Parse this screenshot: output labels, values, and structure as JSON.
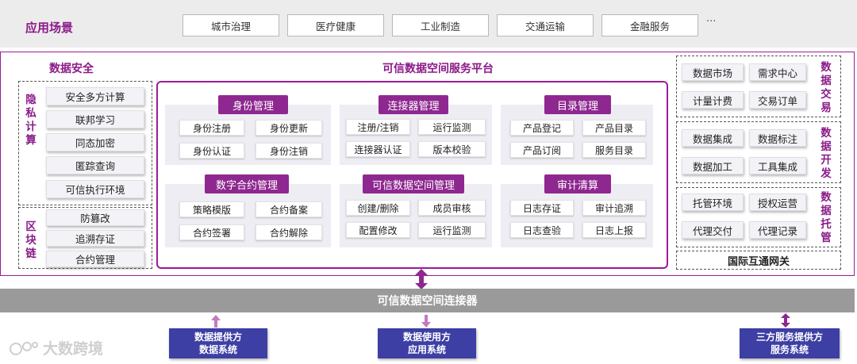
{
  "scenarios": {
    "title": "应用场景",
    "items": [
      "城市治理",
      "医疗健康",
      "工业制造",
      "交通运输",
      "金融服务"
    ],
    "more": "···"
  },
  "data_security": {
    "title": "数据安全",
    "privacy": {
      "label": [
        "隐",
        "私",
        "计",
        "算"
      ],
      "items": [
        "安全多方计算",
        "联邦学习",
        "同态加密",
        "匿踪查询",
        "可信执行环境"
      ]
    },
    "blockchain": {
      "label": [
        "区",
        "块",
        "链"
      ],
      "items": [
        "防篡改",
        "追溯存证",
        "合约管理"
      ]
    }
  },
  "platform": {
    "title": "可信数据空间服务平台",
    "modules": [
      {
        "title": "身份管理",
        "items": [
          "身份注册",
          "身份更新",
          "身份认证",
          "身份注销"
        ]
      },
      {
        "title": "连接器管理",
        "items": [
          "注册/注销",
          "运行监测",
          "连接器认证",
          "版本校验"
        ]
      },
      {
        "title": "目录管理",
        "items": [
          "产品登记",
          "产品目录",
          "产品订阅",
          "服务目录"
        ]
      },
      {
        "title": "数字合约管理",
        "items": [
          "策略模版",
          "合约备案",
          "合约签署",
          "合约解除"
        ]
      },
      {
        "title": "可信数据空间管理",
        "items": [
          "创建/删除",
          "成员审核",
          "配置修改",
          "运行监测"
        ]
      },
      {
        "title": "审计清算",
        "items": [
          "日志存证",
          "审计追溯",
          "日志查验",
          "日志上报"
        ]
      }
    ]
  },
  "right_groups": [
    {
      "label": [
        "数",
        "据",
        "交",
        "易"
      ],
      "items": [
        "数据市场",
        "需求中心",
        "计量计费",
        "交易订单"
      ]
    },
    {
      "label": [
        "数",
        "据",
        "开",
        "发"
      ],
      "items": [
        "数据集成",
        "数据标注",
        "数据加工",
        "工具集成"
      ]
    },
    {
      "label": [
        "数",
        "据",
        "托",
        "管"
      ],
      "items": [
        "托管环境",
        "授权运营",
        "代理交付",
        "代理记录"
      ]
    }
  ],
  "gateway": "国际互通网关",
  "connector": "可信数据空间连接器",
  "bottom": {
    "provider": [
      "数据提供方",
      "数据系统"
    ],
    "user": [
      "数据使用方",
      "应用系统"
    ],
    "third_party": [
      "三方服务提供方",
      "服务系统"
    ]
  },
  "watermark": "大数跨境",
  "colors": {
    "accent": "#8a1a88",
    "module_title": "#8e2890",
    "connector_bar": "#9a9a9a",
    "bottom_box": "#3d3fa4"
  }
}
